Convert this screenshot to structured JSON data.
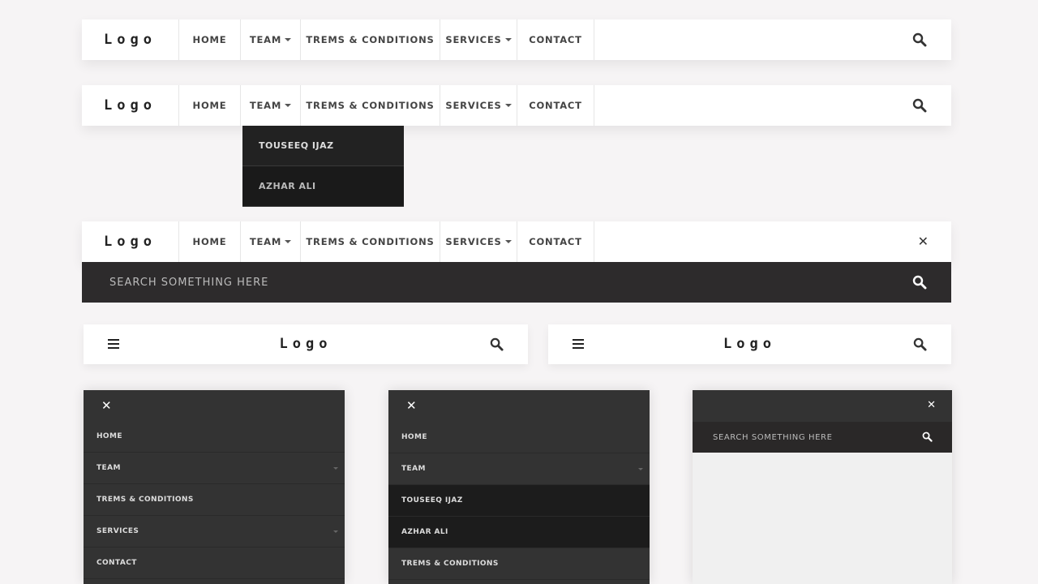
{
  "logo": "Logo",
  "nav": {
    "home": "HOME",
    "team": "TEAM",
    "terms": "TREMS & CONDITIONS",
    "services": "SERVICES",
    "contact": "CONTACT"
  },
  "team_dropdown": [
    "TOUSEEQ IJAZ",
    "AZHAR ALI"
  ],
  "search": {
    "placeholder": "SEARCH SOMETHING HERE"
  },
  "close_glyph": "✕",
  "colors": {
    "dark": "#333333",
    "darker": "#1c1c1c",
    "searchbar": "#2d2b2c"
  }
}
